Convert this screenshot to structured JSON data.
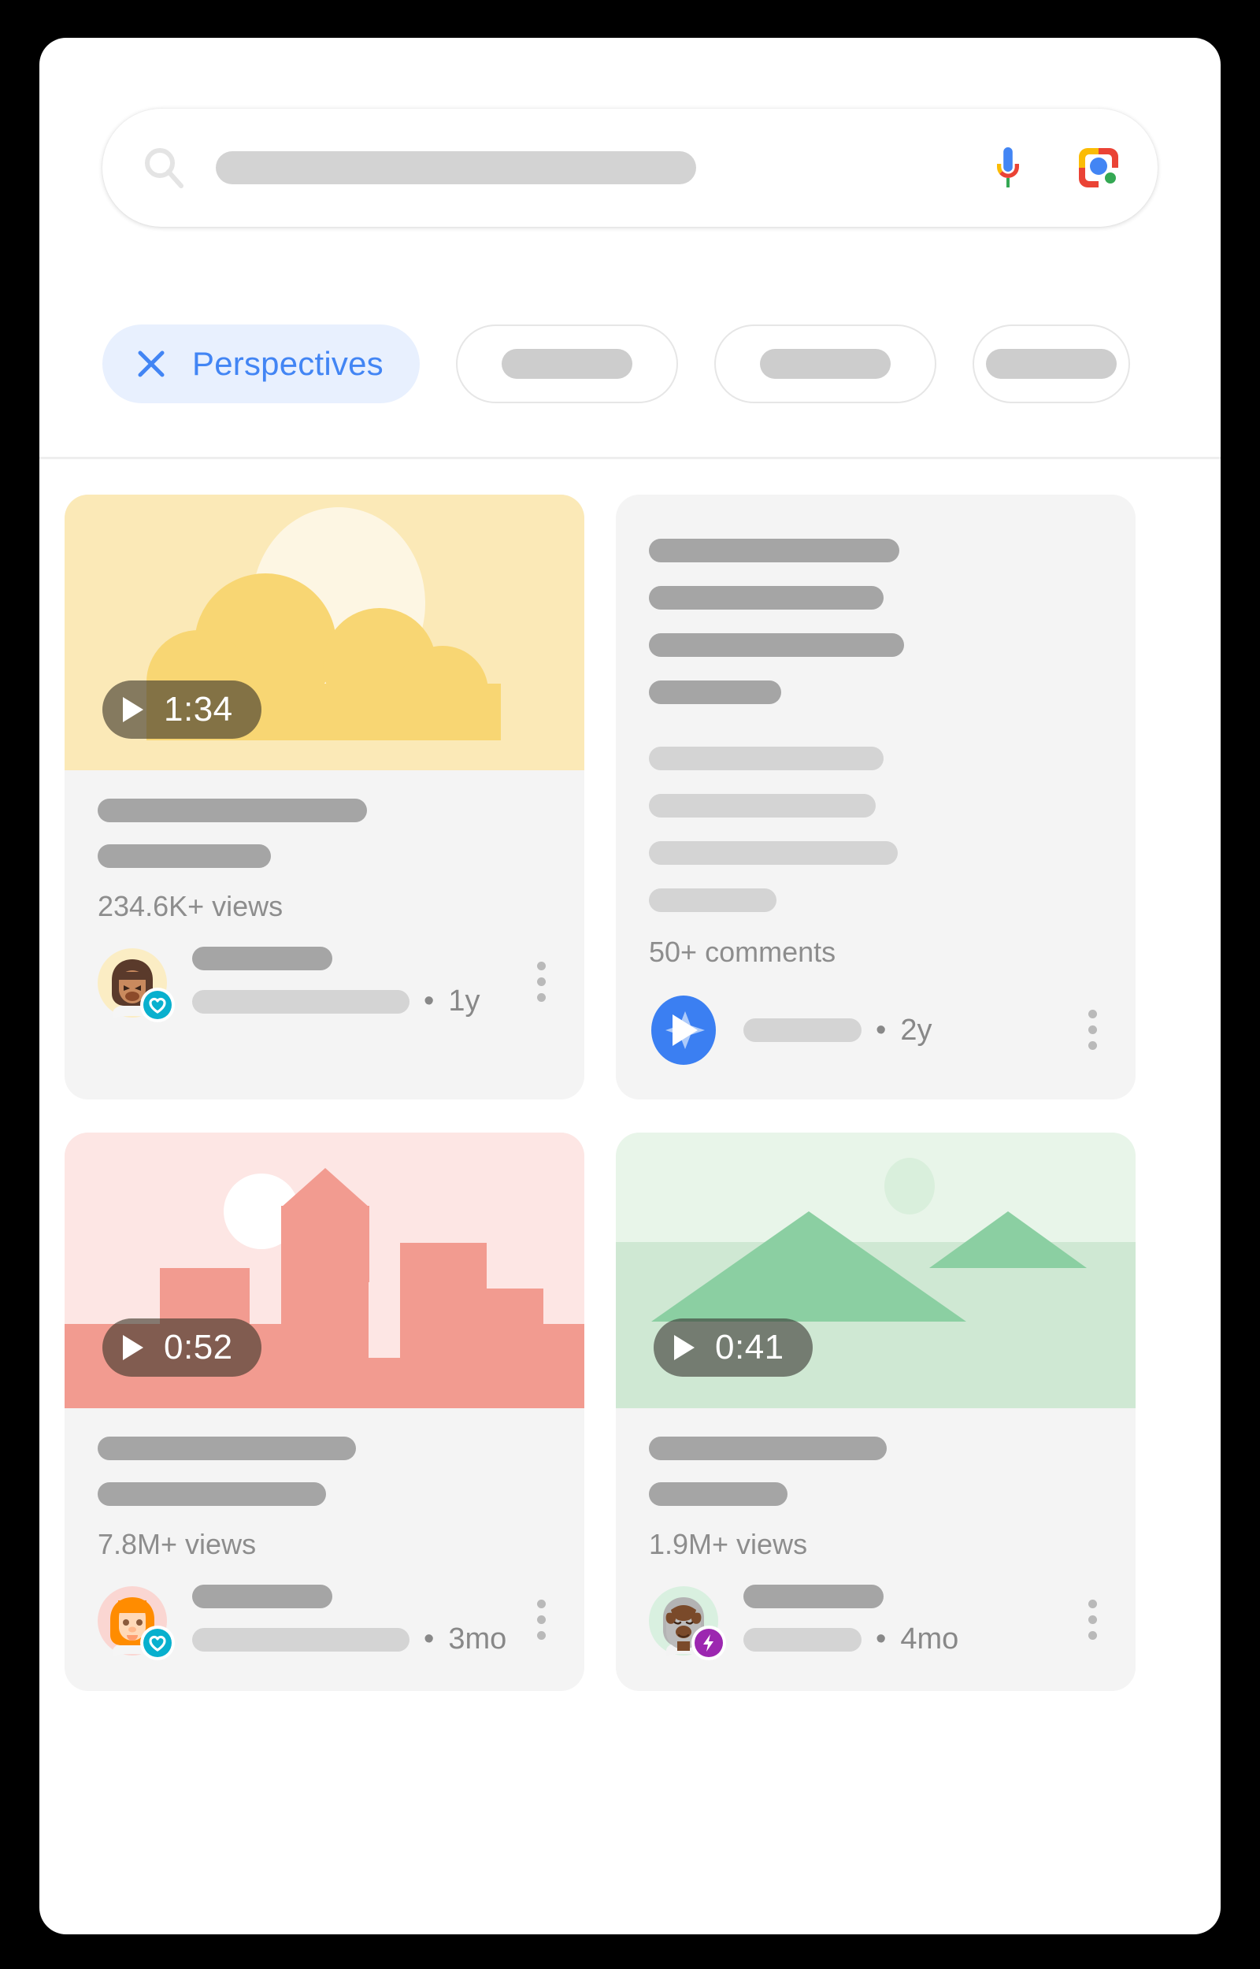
{
  "search": {
    "icon": "search-icon",
    "input_value": "",
    "placeholder": "",
    "mic_icon": "microphone-icon",
    "lens_icon": "google-lens-icon"
  },
  "filters": {
    "active_chip": {
      "label": "Perspectives",
      "icon": "close-x-icon",
      "color": "#4285f4",
      "background": "#e8f0fe"
    },
    "ghost_chips": [
      "",
      "",
      ""
    ]
  },
  "results": [
    {
      "id": "card-video-clouds",
      "type": "video",
      "thumbnail": "clouds-sun-illustration",
      "duration": "1:34",
      "meta": "234.6K+ views",
      "age": "1y",
      "avatar": "woman-dark-hair-avatar",
      "badge": "heart-badge-icon",
      "badge_color": "#09b0ce",
      "menu": "more-options-icon"
    },
    {
      "id": "card-text-comments",
      "type": "text",
      "meta": "50+ comments",
      "age": "2y",
      "avatar": "blue-star-avatar",
      "badge": null,
      "badge_color": "#3b7ff2",
      "menu": "more-options-icon"
    },
    {
      "id": "card-video-city",
      "type": "video",
      "thumbnail": "pink-cityscape-illustration",
      "duration": "0:52",
      "meta": "7.8M+ views",
      "age": "3mo",
      "avatar": "woman-orange-hair-avatar",
      "badge": "heart-badge-icon",
      "badge_color": "#09b0ce",
      "menu": "more-options-icon"
    },
    {
      "id": "card-video-mountains",
      "type": "video",
      "thumbnail": "green-mountains-illustration",
      "duration": "0:41",
      "meta": "1.9M+ views",
      "age": "4mo",
      "avatar": "bearded-elder-avatar",
      "badge": "lightning-bolt-badge-icon",
      "badge_color": "#9c27b0",
      "menu": "more-options-icon"
    }
  ],
  "separators": {
    "bullet": "•"
  }
}
